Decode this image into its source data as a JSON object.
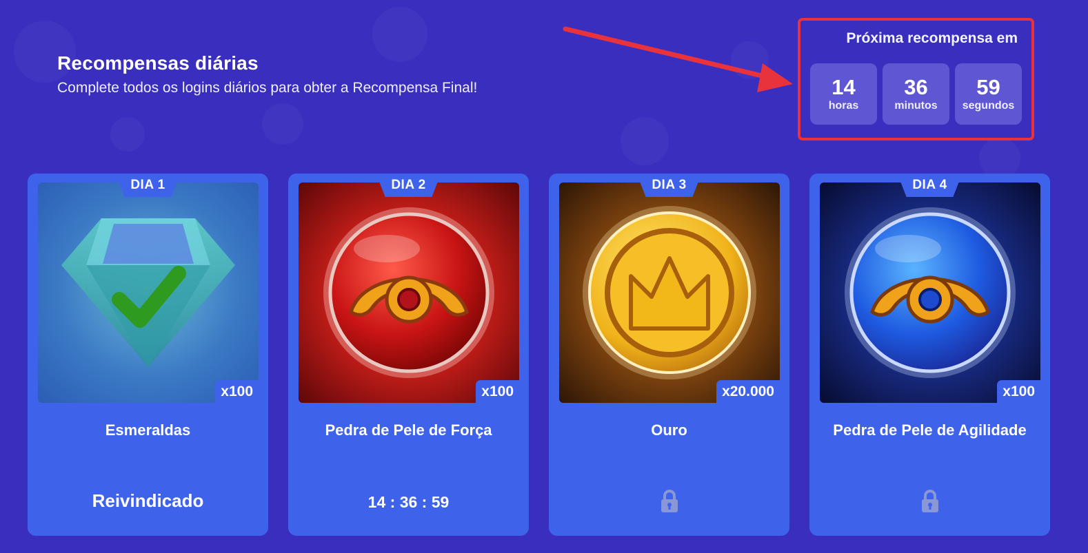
{
  "header": {
    "title": "Recompensas diárias",
    "subtitle": "Complete todos os logins diários para obter a Recompensa Final!"
  },
  "next_reward": {
    "label": "Próxima recompensa em",
    "hours": "14",
    "hours_label": "horas",
    "minutes": "36",
    "minutes_label": "minutos",
    "seconds": "59",
    "seconds_label": "segundos"
  },
  "cards": [
    {
      "day": "DIA 1",
      "quantity": "x100",
      "name": "Esmeraldas",
      "status": "Reivindicado",
      "icon": "emerald-gem-icon",
      "claimed": true
    },
    {
      "day": "DIA 2",
      "quantity": "x100",
      "name": "Pedra de Pele de Força",
      "status": "14 : 36 : 59",
      "icon": "strength-skin-stone-icon"
    },
    {
      "day": "DIA 3",
      "quantity": "x20.000",
      "name": "Ouro",
      "status": "",
      "icon": "gold-coin-icon",
      "locked": true
    },
    {
      "day": "DIA 4",
      "quantity": "x100",
      "name": "Pedra de Pele de Agilidade",
      "status": "",
      "icon": "agility-skin-stone-icon",
      "locked": true
    }
  ],
  "colors": {
    "background": "#3a2ebf",
    "card": "#3f62ea",
    "highlight_border": "#e8333c",
    "claimed_check": "#2e9a1f"
  }
}
